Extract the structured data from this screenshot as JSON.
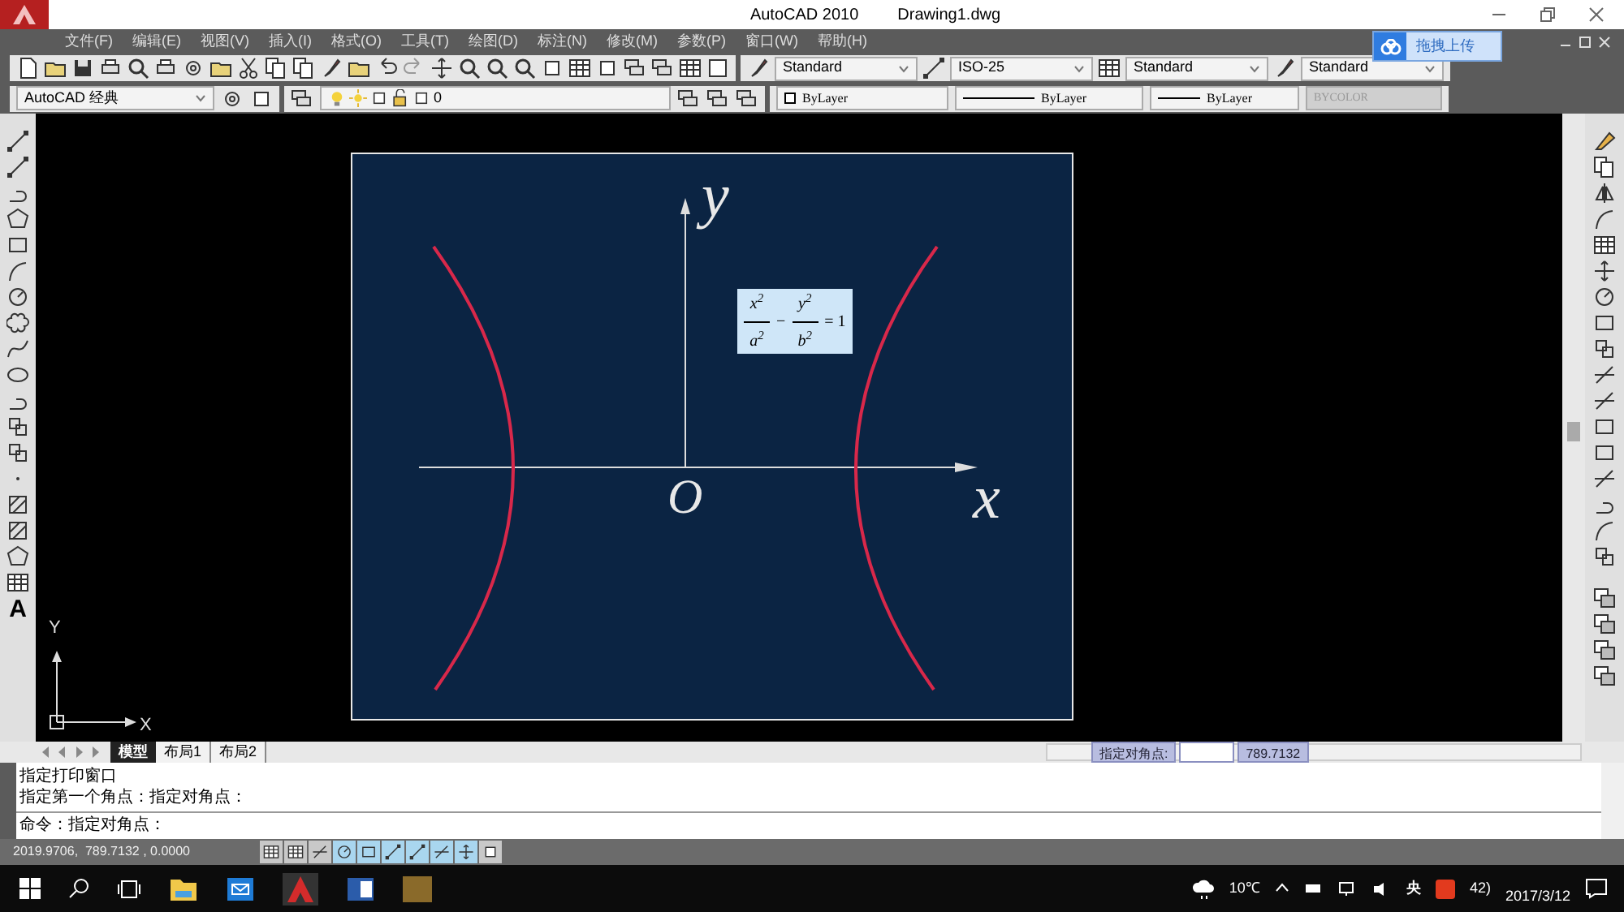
{
  "title_bar": {
    "app": "AutoCAD 2010",
    "document": "Drawing1.dwg"
  },
  "menu": [
    "文件(F)",
    "编辑(E)",
    "视图(V)",
    "插入(I)",
    "格式(O)",
    "工具(T)",
    "绘图(D)",
    "标注(N)",
    "修改(M)",
    "参数(P)",
    "窗口(W)",
    "帮助(H)"
  ],
  "upload_badge": {
    "label": "拖拽上传"
  },
  "style_toolbar": {
    "text_style": "Standard",
    "dim_style": "ISO-25",
    "table_style": "Standard",
    "multileader_style": "Standard"
  },
  "properties_toolbar": {
    "workspace": "AutoCAD 经典",
    "layer": "0",
    "color_value": "ByLayer",
    "linetype": "ByLayer",
    "lineweight": "ByLayer",
    "plot_style": {
      "value": "BYCOLOR",
      "disabled": true
    }
  },
  "left_toolbar": {
    "text_tool": "A"
  },
  "drawing": {
    "y_label": "y",
    "formula": {
      "fractions": [
        {
          "numerator": "x$^{2}$",
          "denominator": "a$^{2}$"
        },
        {
          "numerator": "y$^{2}$",
          "denominator": "b$^{2}$"
        }
      ],
      "operator": "−",
      "equals": "= 1"
    },
    "origin_label": "O",
    "x_label": "x",
    "ucs": {
      "y": "Y",
      "x": "X"
    }
  },
  "layout_tabs": [
    {
      "label": "模型",
      "selected": true
    },
    {
      "label": "布局1",
      "selected": false
    },
    {
      "label": "布局2",
      "selected": false
    }
  ],
  "dynamic_input": {
    "prompt": "指定对角点:",
    "second_value": "789.7132"
  },
  "command_history": [
    "指定打印窗口",
    "指定第一个角点：指定对角点："
  ],
  "command_line": "命令：指定对角点：",
  "status_bar": {
    "coordinates": "2019.9706,  789.7132 , 0.0000",
    "toggles": [
      {
        "on": false
      },
      {
        "on": false
      },
      {
        "on": false
      },
      {
        "on": true
      },
      {
        "on": true
      },
      {
        "on": true
      },
      {
        "on": true
      },
      {
        "on": true
      },
      {
        "on": true
      },
      {
        "on": false
      }
    ]
  },
  "taskbar": {
    "temperature": "10℃",
    "ime": "央",
    "volume_text": "42)",
    "date": "2017/3/12"
  }
}
